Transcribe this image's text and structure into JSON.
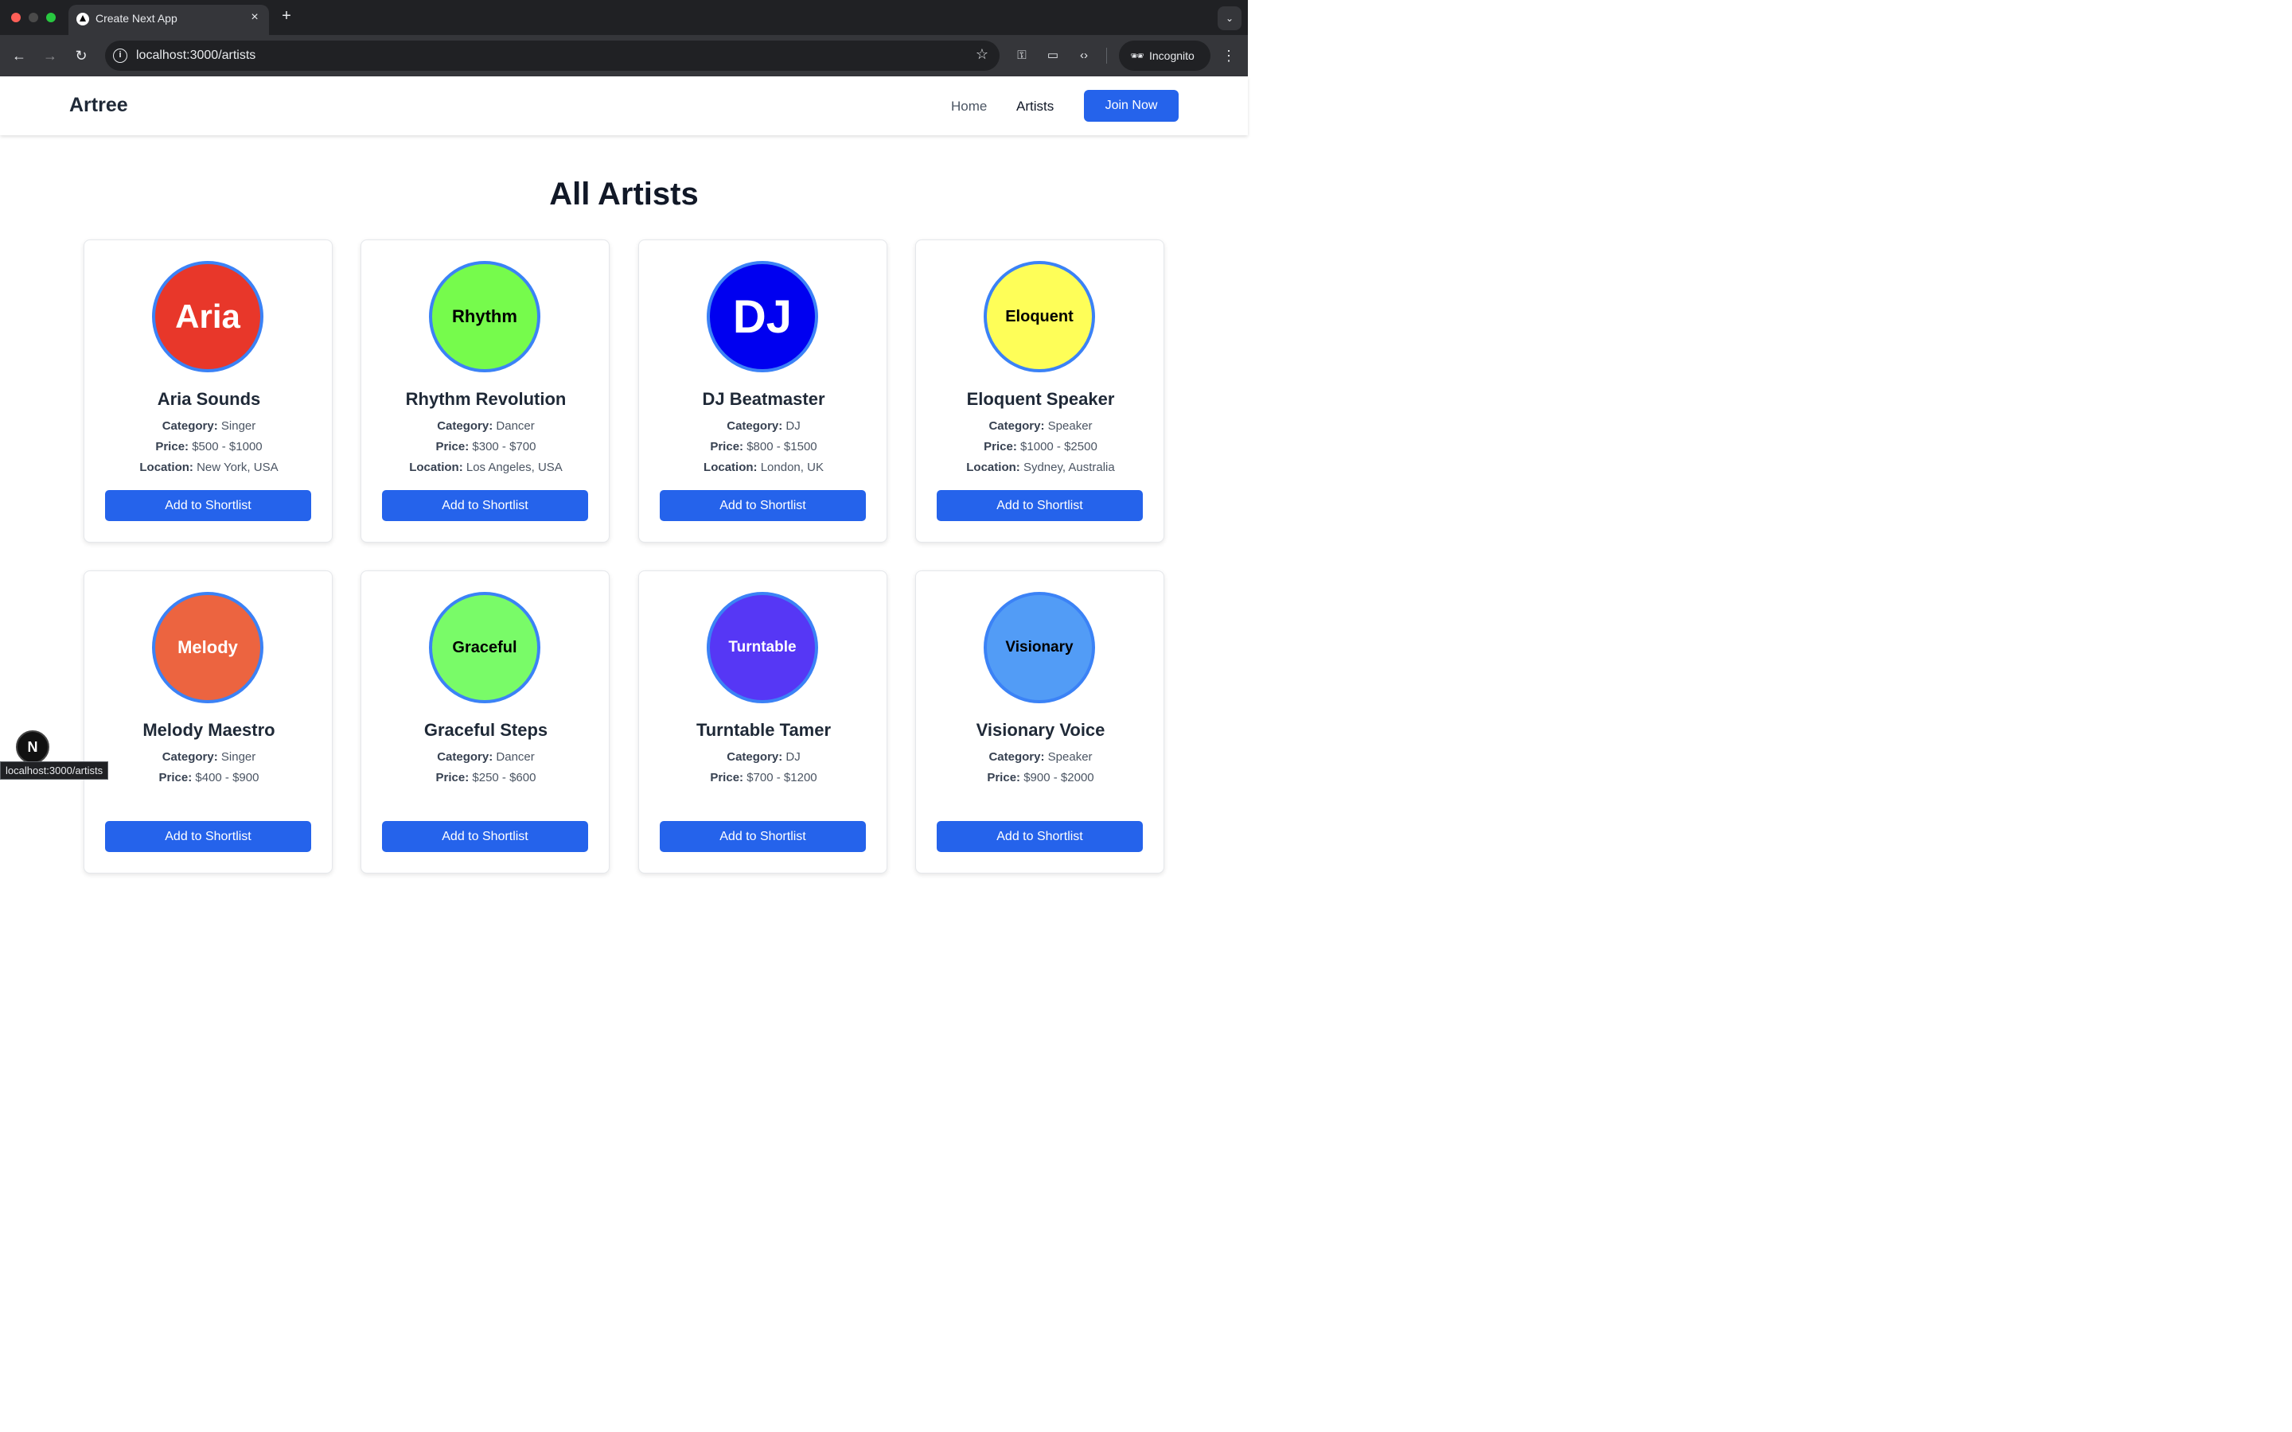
{
  "browser": {
    "tab_title": "Create Next App",
    "tab_close": "×",
    "new_tab": "+",
    "tab_search": "⌄",
    "url": "localhost:3000/artists",
    "incognito_label": "Incognito",
    "icons": {
      "back": "←",
      "forward": "→",
      "reload": "↻",
      "info": "i",
      "star": "☆",
      "key": "⚿",
      "cast": "▭",
      "devtools": "‹›",
      "incognito": "🕶",
      "menu": "⋮"
    }
  },
  "header": {
    "brand": "Artree",
    "nav": {
      "home": "Home",
      "artists": "Artists"
    },
    "join_label": "Join Now"
  },
  "page": {
    "title": "All Artists"
  },
  "labels": {
    "category": "Category:",
    "price": "Price:",
    "location": "Location:",
    "add_button": "Add to Shortlist"
  },
  "artists": [
    {
      "avatar_text": "Aria",
      "avatar_bg": "#e8372a",
      "avatar_fg": "#ffffff",
      "name": "Aria Sounds",
      "category": "Singer",
      "price": "$500 - $1000",
      "location": "New York, USA"
    },
    {
      "avatar_text": "Rhythm",
      "avatar_bg": "#76fb4c",
      "avatar_fg": "#000000",
      "name": "Rhythm Revolution",
      "category": "Dancer",
      "price": "$300 - $700",
      "location": "Los Angeles, USA"
    },
    {
      "avatar_text": "DJ",
      "avatar_bg": "#0000f0",
      "avatar_fg": "#ffffff",
      "name": "DJ Beatmaster",
      "category": "DJ",
      "price": "$800 - $1500",
      "location": "London, UK"
    },
    {
      "avatar_text": "Eloquent",
      "avatar_bg": "#fefe58",
      "avatar_fg": "#000000",
      "name": "Eloquent Speaker",
      "category": "Speaker",
      "price": "$1000 - $2500",
      "location": "Sydney, Australia"
    },
    {
      "avatar_text": "Melody",
      "avatar_bg": "#ec6440",
      "avatar_fg": "#ffffff",
      "name": "Melody Maestro",
      "category": "Singer",
      "price": "$400 - $900",
      "location": ""
    },
    {
      "avatar_text": "Graceful",
      "avatar_bg": "#79fb68",
      "avatar_fg": "#000000",
      "name": "Graceful Steps",
      "category": "Dancer",
      "price": "$250 - $600",
      "location": ""
    },
    {
      "avatar_text": "Turntable",
      "avatar_bg": "#5637f5",
      "avatar_fg": "#ffffff",
      "name": "Turntable Tamer",
      "category": "DJ",
      "price": "$700 - $1200",
      "location": ""
    },
    {
      "avatar_text": "Visionary",
      "avatar_bg": "#529cf6",
      "avatar_fg": "#000000",
      "name": "Visionary Voice",
      "category": "Speaker",
      "price": "$900 - $2000",
      "location": ""
    }
  ],
  "overlay": {
    "next_badge": "N",
    "status_url": "localhost:3000/artists"
  }
}
